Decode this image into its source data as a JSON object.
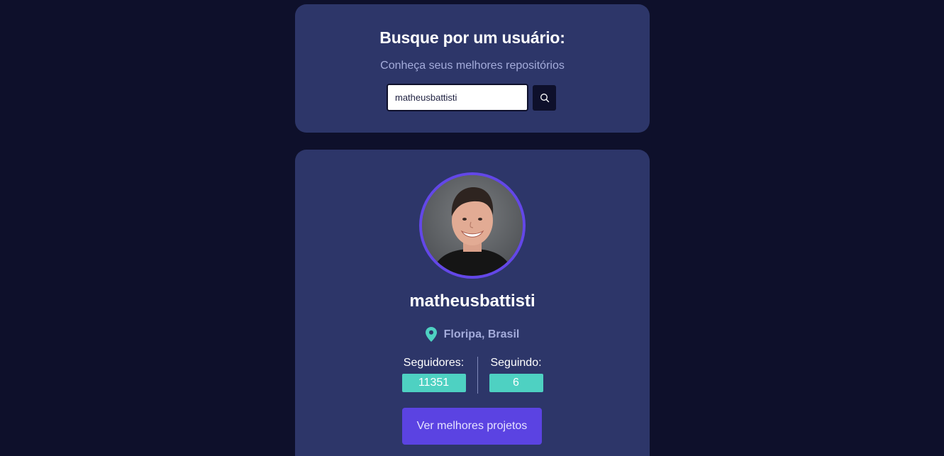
{
  "search": {
    "title": "Busque por um usuário:",
    "subtitle": "Conheça seus melhores repositórios",
    "input_value": "matheusbattisti",
    "button_icon": "search-icon"
  },
  "profile": {
    "username": "matheusbattisti",
    "location": "Floripa, Brasil",
    "location_icon": "map-pin-icon",
    "followers_label": "Seguidores:",
    "followers_count": "11351",
    "following_label": "Seguindo:",
    "following_count": "6",
    "projects_button_label": "Ver melhores projetos"
  },
  "colors": {
    "background": "#0e102b",
    "card": "#2d3669",
    "accent_purple": "#5b43e2",
    "accent_teal": "#4ed1c2",
    "muted_text": "#a4acdb"
  }
}
